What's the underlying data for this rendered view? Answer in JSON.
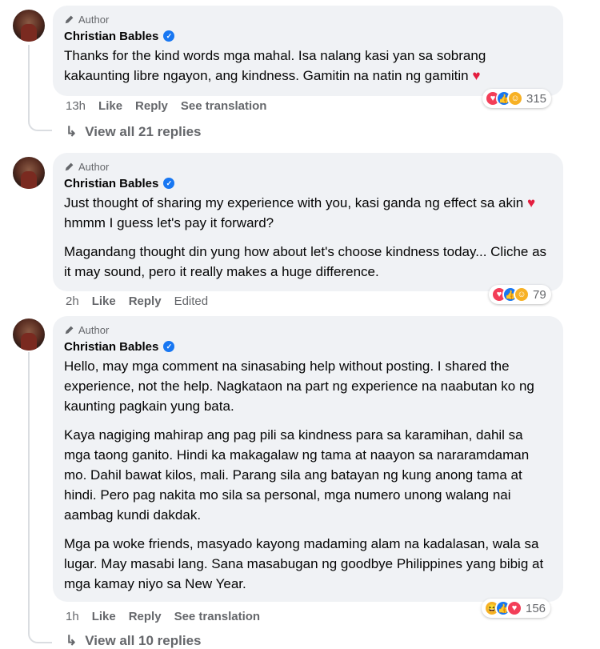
{
  "comments": [
    {
      "author_badge": "Author",
      "name": "Christian Bables",
      "paragraphs": [
        "Thanks for the kind words mga mahal. Isa nalang kasi yan sa sobrang kakaunting libre ngayon, ang kindness. Gamitin na natin ng gamitin"
      ],
      "time": "13h",
      "like": "Like",
      "reply": "Reply",
      "extra": "See translation",
      "reaction_count": "315",
      "view_replies": "View all 21 replies"
    },
    {
      "author_badge": "Author",
      "name": "Christian Bables",
      "p1a": "Just thought of sharing my experience with you, kasi ganda ng effect sa akin",
      "p1b": "hmmm I guess let's pay it forward?",
      "p2": "Magandang thought din yung how about let's choose kindness today... Cliche as it may sound, pero it really makes a huge difference.",
      "time": "2h",
      "like": "Like",
      "reply": "Reply",
      "extra": "Edited",
      "reaction_count": "79"
    },
    {
      "author_badge": "Author",
      "name": "Christian Bables",
      "paragraphs": [
        "Hello, may mga comment na sinasabing help without posting. I shared the experience, not the help. Nagkataon na part ng experience na naabutan ko ng kaunting pagkain yung bata.",
        "Kaya nagiging mahirap ang pag pili sa kindness para sa karamihan, dahil sa mga taong ganito. Hindi ka makagalaw ng tama at naayon sa nararamdaman mo. Dahil bawat kilos, mali. Parang sila ang batayan ng kung anong tama at hindi. Pero pag nakita mo sila sa personal, mga numero unong walang nai aambag kundi dakdak.",
        "Mga pa woke friends, masyado kayong madaming alam na kadalasan, wala sa lugar. May masabi lang. Sana masabugan ng goodbye Philippines yang bibig at mga kamay niyo sa New Year."
      ],
      "time": "1h",
      "like": "Like",
      "reply": "Reply",
      "extra": "See translation",
      "reaction_count": "156",
      "view_replies": "View all 10 replies"
    }
  ],
  "icons": {
    "heart": "♥",
    "reply_arrow": "↳"
  },
  "colors": {
    "bubble": "#f0f2f5",
    "verified": "#1877f2",
    "heart": "#e41e3f",
    "muted": "#65676b"
  }
}
